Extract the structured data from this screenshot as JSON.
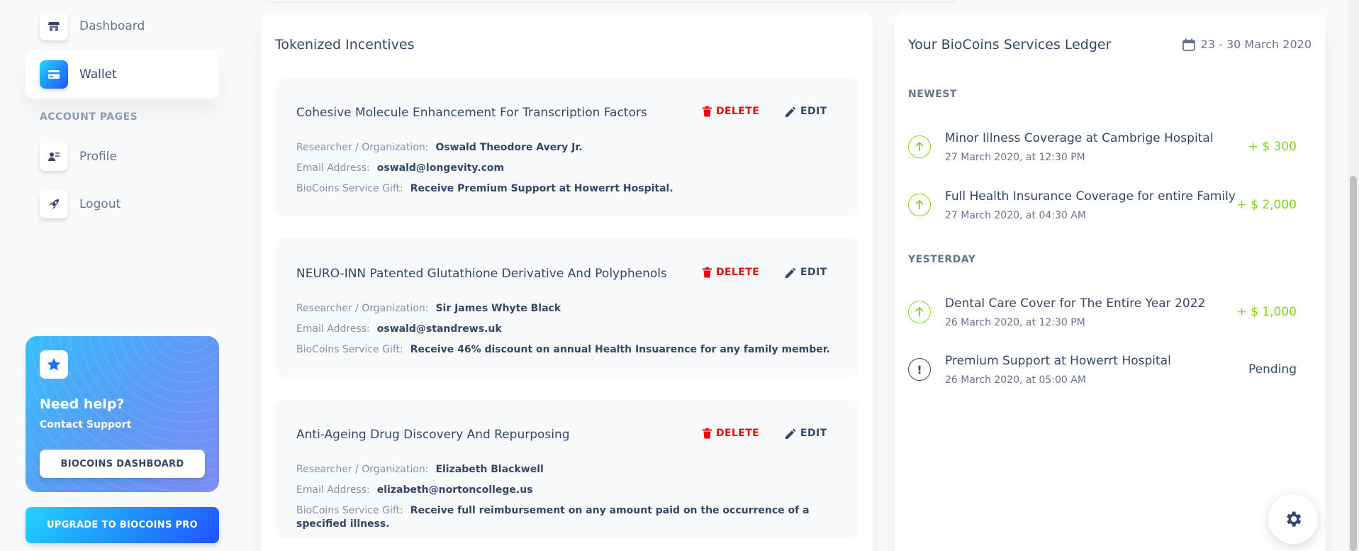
{
  "sidebar": {
    "items": [
      {
        "label": "Dashboard",
        "icon": "shop-icon",
        "active": false
      },
      {
        "label": "Wallet",
        "icon": "credit-card-icon",
        "active": true
      }
    ],
    "section_label": "ACCOUNT PAGES",
    "account_items": [
      {
        "label": "Profile",
        "icon": "user-card-icon"
      },
      {
        "label": "Logout",
        "icon": "rocket-icon"
      }
    ],
    "help": {
      "title": "Need help?",
      "subtitle": "Contact Support",
      "button": "BIOCOINS DASHBOARD"
    },
    "upgrade_button": "UPGRADE TO BIOCOINS PRO"
  },
  "incentives": {
    "title": "Tokenized Incentives",
    "delete_label": "DELETE",
    "edit_label": "EDIT",
    "labels": {
      "researcher": "Researcher / Organization:",
      "email": "Email Address:",
      "gift": "BioCoins Service Gift:"
    },
    "items": [
      {
        "name": "Cohesive Molecule Enhancement For Transcription Factors",
        "researcher": "Oswald Theodore Avery Jr.",
        "email": "oswald@longevity.com",
        "gift": "Receive Premium Support at Howerrt Hospital."
      },
      {
        "name": "NEURO-INN Patented Glutathione Derivative And Polyphenols",
        "researcher": "Sir James Whyte Black",
        "email": "oswald@standrews.uk",
        "gift": "Receive 46% discount on annual Health Insuarence for any family member."
      },
      {
        "name": "Anti-Ageing Drug Discovery And Repurposing",
        "researcher": "Elizabeth Blackwell",
        "email": "elizabeth@nortoncollege.us",
        "gift": "Receive full reimbursement on any amount paid on the occurrence of a specified illness."
      }
    ]
  },
  "ledger": {
    "title": "Your BioCoins Services Ledger",
    "date_range": "23 - 30 March 2020",
    "sections": [
      {
        "label": "NEWEST",
        "transactions": [
          {
            "title": "Minor Illness Coverage at Cambrige Hospital",
            "date": "27 March 2020, at 12:30 PM",
            "amount": "+ $ 300",
            "status": "up"
          },
          {
            "title": "Full Health Insurance Coverage for entire Family",
            "date": "27 March 2020, at 04:30 AM",
            "amount": "+ $ 2,000",
            "status": "up"
          }
        ]
      },
      {
        "label": "YESTERDAY",
        "transactions": [
          {
            "title": "Dental Care Cover for The Entire Year 2022",
            "date": "26 March 2020, at 12:30 PM",
            "amount": "+ $ 1,000",
            "status": "up"
          },
          {
            "title": "Premium Support at Howerrt Hospital",
            "date": "26 March 2020, at 05:00 AM",
            "amount": "Pending",
            "status": "pending"
          }
        ]
      }
    ]
  },
  "colors": {
    "accent_gradient_start": "#2152ff",
    "accent_gradient_end": "#21d4fd",
    "danger": "#ea0606",
    "success": "#82d616",
    "text_dark": "#344767",
    "text_muted": "#67748e"
  }
}
